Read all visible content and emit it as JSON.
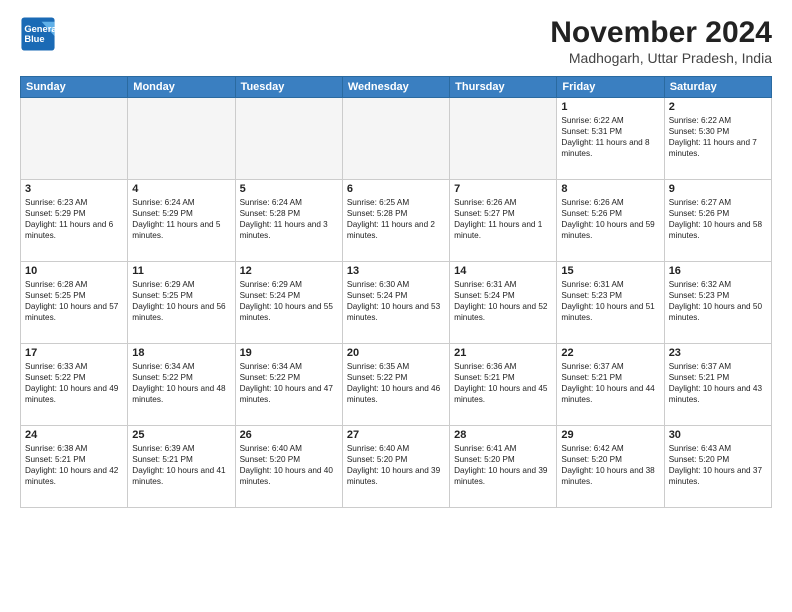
{
  "logo": {
    "line1": "General",
    "line2": "Blue"
  },
  "title": "November 2024",
  "location": "Madhogarh, Uttar Pradesh, India",
  "weekdays": [
    "Sunday",
    "Monday",
    "Tuesday",
    "Wednesday",
    "Thursday",
    "Friday",
    "Saturday"
  ],
  "weeks": [
    [
      {
        "day": "",
        "text": ""
      },
      {
        "day": "",
        "text": ""
      },
      {
        "day": "",
        "text": ""
      },
      {
        "day": "",
        "text": ""
      },
      {
        "day": "",
        "text": ""
      },
      {
        "day": "1",
        "text": "Sunrise: 6:22 AM\nSunset: 5:31 PM\nDaylight: 11 hours and 8 minutes."
      },
      {
        "day": "2",
        "text": "Sunrise: 6:22 AM\nSunset: 5:30 PM\nDaylight: 11 hours and 7 minutes."
      }
    ],
    [
      {
        "day": "3",
        "text": "Sunrise: 6:23 AM\nSunset: 5:29 PM\nDaylight: 11 hours and 6 minutes."
      },
      {
        "day": "4",
        "text": "Sunrise: 6:24 AM\nSunset: 5:29 PM\nDaylight: 11 hours and 5 minutes."
      },
      {
        "day": "5",
        "text": "Sunrise: 6:24 AM\nSunset: 5:28 PM\nDaylight: 11 hours and 3 minutes."
      },
      {
        "day": "6",
        "text": "Sunrise: 6:25 AM\nSunset: 5:28 PM\nDaylight: 11 hours and 2 minutes."
      },
      {
        "day": "7",
        "text": "Sunrise: 6:26 AM\nSunset: 5:27 PM\nDaylight: 11 hours and 1 minute."
      },
      {
        "day": "8",
        "text": "Sunrise: 6:26 AM\nSunset: 5:26 PM\nDaylight: 10 hours and 59 minutes."
      },
      {
        "day": "9",
        "text": "Sunrise: 6:27 AM\nSunset: 5:26 PM\nDaylight: 10 hours and 58 minutes."
      }
    ],
    [
      {
        "day": "10",
        "text": "Sunrise: 6:28 AM\nSunset: 5:25 PM\nDaylight: 10 hours and 57 minutes."
      },
      {
        "day": "11",
        "text": "Sunrise: 6:29 AM\nSunset: 5:25 PM\nDaylight: 10 hours and 56 minutes."
      },
      {
        "day": "12",
        "text": "Sunrise: 6:29 AM\nSunset: 5:24 PM\nDaylight: 10 hours and 55 minutes."
      },
      {
        "day": "13",
        "text": "Sunrise: 6:30 AM\nSunset: 5:24 PM\nDaylight: 10 hours and 53 minutes."
      },
      {
        "day": "14",
        "text": "Sunrise: 6:31 AM\nSunset: 5:24 PM\nDaylight: 10 hours and 52 minutes."
      },
      {
        "day": "15",
        "text": "Sunrise: 6:31 AM\nSunset: 5:23 PM\nDaylight: 10 hours and 51 minutes."
      },
      {
        "day": "16",
        "text": "Sunrise: 6:32 AM\nSunset: 5:23 PM\nDaylight: 10 hours and 50 minutes."
      }
    ],
    [
      {
        "day": "17",
        "text": "Sunrise: 6:33 AM\nSunset: 5:22 PM\nDaylight: 10 hours and 49 minutes."
      },
      {
        "day": "18",
        "text": "Sunrise: 6:34 AM\nSunset: 5:22 PM\nDaylight: 10 hours and 48 minutes."
      },
      {
        "day": "19",
        "text": "Sunrise: 6:34 AM\nSunset: 5:22 PM\nDaylight: 10 hours and 47 minutes."
      },
      {
        "day": "20",
        "text": "Sunrise: 6:35 AM\nSunset: 5:22 PM\nDaylight: 10 hours and 46 minutes."
      },
      {
        "day": "21",
        "text": "Sunrise: 6:36 AM\nSunset: 5:21 PM\nDaylight: 10 hours and 45 minutes."
      },
      {
        "day": "22",
        "text": "Sunrise: 6:37 AM\nSunset: 5:21 PM\nDaylight: 10 hours and 44 minutes."
      },
      {
        "day": "23",
        "text": "Sunrise: 6:37 AM\nSunset: 5:21 PM\nDaylight: 10 hours and 43 minutes."
      }
    ],
    [
      {
        "day": "24",
        "text": "Sunrise: 6:38 AM\nSunset: 5:21 PM\nDaylight: 10 hours and 42 minutes."
      },
      {
        "day": "25",
        "text": "Sunrise: 6:39 AM\nSunset: 5:21 PM\nDaylight: 10 hours and 41 minutes."
      },
      {
        "day": "26",
        "text": "Sunrise: 6:40 AM\nSunset: 5:20 PM\nDaylight: 10 hours and 40 minutes."
      },
      {
        "day": "27",
        "text": "Sunrise: 6:40 AM\nSunset: 5:20 PM\nDaylight: 10 hours and 39 minutes."
      },
      {
        "day": "28",
        "text": "Sunrise: 6:41 AM\nSunset: 5:20 PM\nDaylight: 10 hours and 39 minutes."
      },
      {
        "day": "29",
        "text": "Sunrise: 6:42 AM\nSunset: 5:20 PM\nDaylight: 10 hours and 38 minutes."
      },
      {
        "day": "30",
        "text": "Sunrise: 6:43 AM\nSunset: 5:20 PM\nDaylight: 10 hours and 37 minutes."
      }
    ]
  ]
}
